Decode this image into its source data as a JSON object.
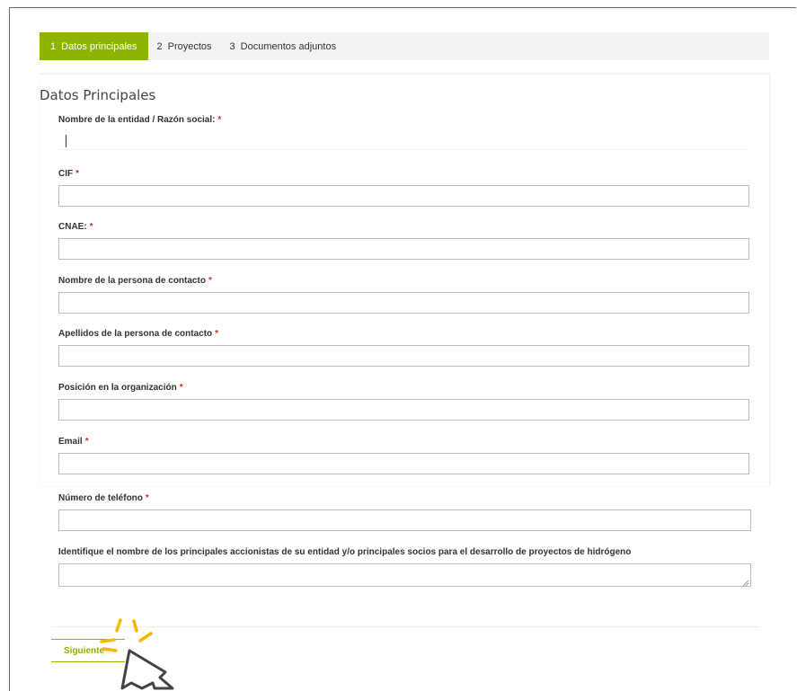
{
  "tabs": [
    {
      "num": "1",
      "label": "Datos principales",
      "active": true
    },
    {
      "num": "2",
      "label": "Proyectos",
      "active": false
    },
    {
      "num": "3",
      "label": "Documentos adjuntos",
      "active": false
    }
  ],
  "section": {
    "title": "Datos Principales"
  },
  "fields": {
    "entity_name": {
      "label": "Nombre de la entidad / Razón social:",
      "required": "*",
      "value": ""
    },
    "cif": {
      "label": "CIF",
      "required": "*",
      "value": ""
    },
    "cnae": {
      "label": "CNAE:",
      "required": "*",
      "value": ""
    },
    "contact_name": {
      "label": "Nombre de la persona de contacto",
      "required": "*",
      "value": ""
    },
    "contact_surname": {
      "label": "Apellidos de la persona de contacto",
      "required": "*",
      "value": ""
    },
    "position": {
      "label": "Posición en la organización",
      "required": "*",
      "value": ""
    },
    "email": {
      "label": "Email",
      "required": "*",
      "value": ""
    },
    "phone": {
      "label": "Número de teléfono",
      "required": "*",
      "value": ""
    },
    "shareholders": {
      "label": "Identifique el nombre de los principales accionistas de su entidad y/o principales socios para el desarrollo de proyectos de hidrógeno",
      "value": ""
    }
  },
  "actions": {
    "next_label": "Siguiente"
  },
  "colors": {
    "accent": "#8cb400",
    "required": "#c0392b",
    "cursor_burst": "#f5b800"
  }
}
